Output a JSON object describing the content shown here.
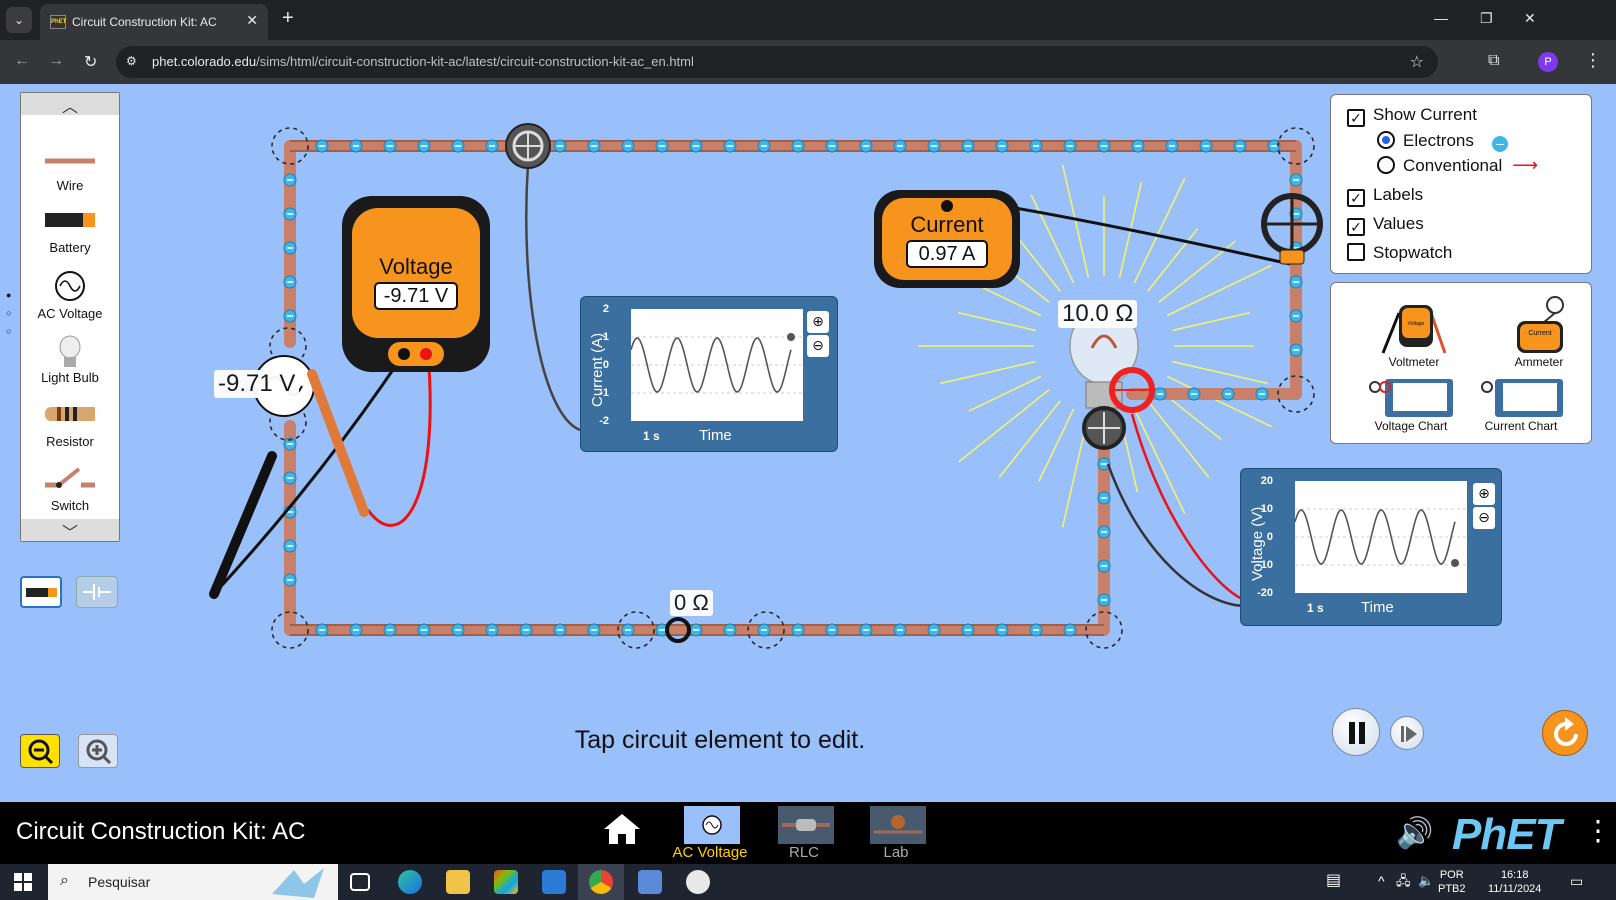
{
  "browser": {
    "tab_title": "Circuit Construction Kit: AC",
    "favicon_text": "PhET",
    "url_host": "phet.colorado.edu",
    "url_path": "/sims/html/circuit-construction-kit-ac/latest/circuit-construction-kit-ac_en.html",
    "profile_initial": "P"
  },
  "toolbox": {
    "items": [
      {
        "label": "Wire",
        "icon": "wire-icon"
      },
      {
        "label": "Battery",
        "icon": "battery-icon"
      },
      {
        "label": "AC Voltage",
        "icon": "ac-source-icon"
      },
      {
        "label": "Light Bulb",
        "icon": "light-bulb-icon"
      },
      {
        "label": "Resistor",
        "icon": "resistor-icon"
      },
      {
        "label": "Switch",
        "icon": "switch-icon"
      }
    ]
  },
  "circuit": {
    "source_voltage_label": "-9.71 V",
    "bulb_resistance_label": "10.0 Ω",
    "wire_resistance_label": "0 Ω"
  },
  "voltmeter": {
    "title": "Voltage",
    "value": "-9.71 V"
  },
  "ammeter": {
    "title": "Current",
    "value": "0.97 A"
  },
  "current_chart": {
    "ylabel": "Current (A)",
    "xlabel": "Time",
    "yticks": [
      "2",
      "1",
      "0",
      "-1",
      "-2"
    ],
    "time_scale": "1 s"
  },
  "voltage_chart": {
    "ylabel": "Voltage (V)",
    "xlabel": "Time",
    "yticks": [
      "20",
      "10",
      "0",
      "-10",
      "-20"
    ],
    "time_scale": "1 s"
  },
  "options_panel": {
    "show_current": {
      "label": "Show Current",
      "checked": true
    },
    "electrons": {
      "label": "Electrons",
      "selected": true
    },
    "conventional": {
      "label": "Conventional",
      "selected": false
    },
    "labels": {
      "label": "Labels",
      "checked": true
    },
    "values": {
      "label": "Values",
      "checked": true
    },
    "stopwatch": {
      "label": "Stopwatch",
      "checked": false
    }
  },
  "sensor_panel": {
    "voltmeter_label": "Voltmeter",
    "ammeter_label": "Ammeter",
    "voltage_chart_label": "Voltage Chart",
    "current_chart_label": "Current Chart",
    "mini_voltmeter_text": "Voltage",
    "mini_ammeter_text": "Current"
  },
  "hint": "Tap circuit element to edit.",
  "navbar": {
    "sim_title": "Circuit Construction Kit: AC",
    "screens": [
      {
        "label": "AC Voltage",
        "active": true
      },
      {
        "label": "RLC",
        "active": false
      },
      {
        "label": "Lab",
        "active": false
      }
    ],
    "logo": "PhET"
  },
  "taskbar": {
    "search_placeholder": "Pesquisar",
    "language": "POR",
    "keyboard": "PTB2",
    "time": "16:18",
    "date": "11/11/2024"
  },
  "colors": {
    "sim_background": "#99c0fb",
    "wire_copper": "#c8806a",
    "electron_blue": "#3fb6e8",
    "meter_orange": "#f7941d",
    "chart_panel": "#3a6fa0",
    "active_screen": "#ffd000"
  }
}
